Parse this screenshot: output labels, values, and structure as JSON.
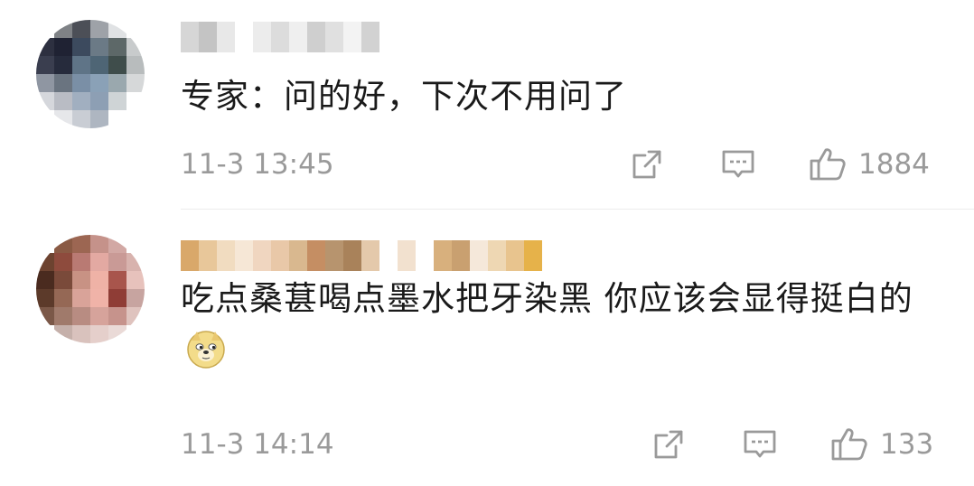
{
  "comments": [
    {
      "time": "11-3 13:45",
      "text": "专家：问的好，下次不用问了",
      "likes": "1884",
      "username_blur_colors": [
        "#d6d6d6",
        "#c4c4c4",
        "#e8e8e8",
        "#ffffff",
        "#ececec",
        "#dcdcdc",
        "#efefef",
        "#cfcfcf",
        "#e0e0e0",
        "#f3f3f3",
        "#d2d2d2"
      ],
      "avatar_colors": [
        "#ffffff",
        "#7f8286",
        "#4c4f57",
        "#9ea2a8",
        "#e0e2e4",
        "#ffffff",
        "#2d3040",
        "#1f2233",
        "#3c4a5e",
        "#6b7a86",
        "#5d6868",
        "#c8cbcc",
        "#3a3e4f",
        "#262b3c",
        "#5f7487",
        "#4e6575",
        "#3f4d4b",
        "#b8bcbd",
        "#8f96a2",
        "#6a7480",
        "#7a8fa6",
        "#8aa1b7",
        "#9aa8ae",
        "#d6d8d9",
        "#d5d7dc",
        "#b9bcc4",
        "#a1afc0",
        "#8d9fb4",
        "#cfd4d6",
        "#ffffff",
        "#ffffff",
        "#e6e7ea",
        "#c9cdd4",
        "#aeb6c1",
        "#ffffff",
        "#ffffff"
      ]
    },
    {
      "time": "11-3 14:14",
      "text": "吃点桑葚喝点墨水把牙染黑 你应该会显得挺白的",
      "emoji": "doge-emoji",
      "likes": "133",
      "username_blur_colors": [
        "#d9a86a",
        "#e8c79a",
        "#f1dcc0",
        "#f6e7d6",
        "#f0d6c0",
        "#e9c8a8",
        "#d9b88f",
        "#c58e63",
        "#b7946e",
        "#a9825a",
        "#e4c9ab",
        "#ffffff",
        "#f2e1cf",
        "#ffffff",
        "#d8b07d",
        "#c9a070",
        "#f5e8da",
        "#eed7b3",
        "#e8c48e",
        "#e6b24a"
      ],
      "avatar_colors": [
        "#ffffff",
        "#8a5a44",
        "#9c6652",
        "#c5928a",
        "#d2a8a4",
        "#ffffff",
        "#6d4330",
        "#8e4b3d",
        "#b97a73",
        "#e3a9a2",
        "#c99a96",
        "#d8b3ae",
        "#4a2b1f",
        "#7a4a3a",
        "#c89284",
        "#efb2a6",
        "#a8554c",
        "#e7c2bc",
        "#5c3a2a",
        "#956855",
        "#d9a399",
        "#f0b3a8",
        "#8f3d36",
        "#c7a4a0",
        "#7b5848",
        "#a07a6b",
        "#b88c82",
        "#d6a39b",
        "#c6938c",
        "#dfc3be",
        "#ffffff",
        "#c5b0aa",
        "#d9c2bd",
        "#e5cfcb",
        "#eadad7",
        "#ffffff"
      ]
    }
  ],
  "icons": {
    "share": "share-icon",
    "reply": "comment-icon",
    "like": "thumbs-up-icon"
  },
  "colors": {
    "text": "#1a1a1a",
    "meta": "#9a9a9a",
    "divider": "#ececec"
  }
}
